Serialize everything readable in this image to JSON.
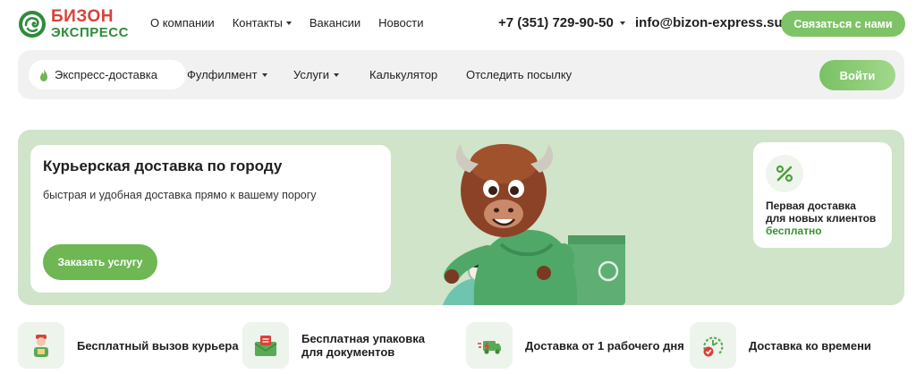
{
  "brand": {
    "line1": "БИЗОН",
    "line2": "ЭКСПРЕСС",
    "red": "#d9413a",
    "green": "#2e8b3a"
  },
  "topnav": [
    {
      "label": "О компании",
      "dropdown": false
    },
    {
      "label": "Контакты",
      "dropdown": true
    },
    {
      "label": "Вакансии",
      "dropdown": false
    },
    {
      "label": "Новости",
      "dropdown": false
    }
  ],
  "contacts": {
    "phone": "+7 (351) 729-90-50",
    "email": "info@bizon-express.su",
    "cta": "Связаться с нами"
  },
  "navbar": {
    "active": "Экспресс-доставка",
    "items": [
      {
        "label": "Фулфилмент",
        "dropdown": true
      },
      {
        "label": "Услуги",
        "dropdown": true
      },
      {
        "label": "Калькулятор",
        "dropdown": false
      },
      {
        "label": "Отследить посылку",
        "dropdown": false
      }
    ],
    "login": "Войти"
  },
  "hero": {
    "title": "Курьерская доставка по городу",
    "subtitle": "быстрая и удобная доставка прямо к вашему порогу",
    "button": "Заказать услугу",
    "promo": {
      "line1": "Первая доставка",
      "line2": "для новых клиентов",
      "highlight": "бесплатно",
      "icon": "percent-icon"
    }
  },
  "features": [
    {
      "label": "Бесплатный вызов курьера",
      "icon": "courier-icon"
    },
    {
      "label": "Бесплатная упаковка для документов",
      "icon": "envelope-icon"
    },
    {
      "label": "Доставка от 1 рабочего дня",
      "icon": "fast-truck-icon"
    },
    {
      "label": "Доставка ко времени",
      "icon": "clock-check-icon"
    }
  ],
  "colors": {
    "accent": "#7ec466",
    "hero_bg": "#cfe4c9",
    "nav_bg": "#f1f1f1"
  }
}
